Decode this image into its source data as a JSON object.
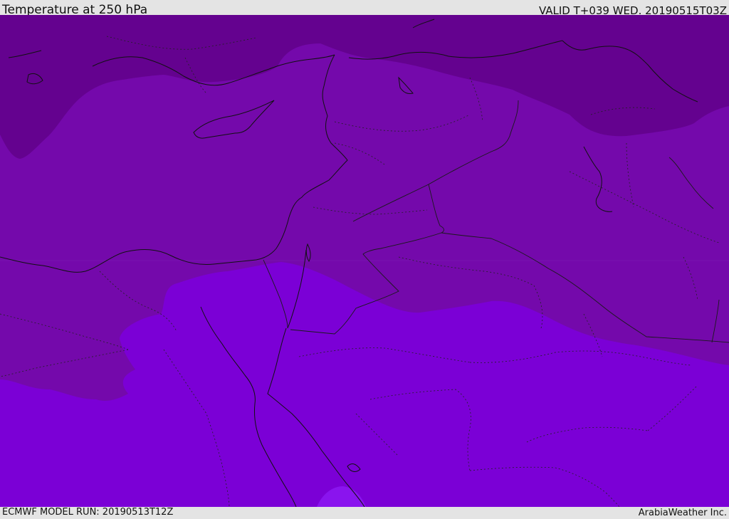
{
  "header": {
    "title": "Temperature at 250 hPa",
    "valid_time": "VALID T+039 WED. 20190515T03Z"
  },
  "footer": {
    "model_run": "ECMWF MODEL RUN: 20190513T12Z",
    "credit": "ArabiaWeather Inc."
  },
  "map": {
    "field": "temperature_250hPa",
    "colors": {
      "coldest": "#64028f",
      "cold": "#7409ab",
      "mild": "#7b00d6",
      "warm_spot": "#8a14ee",
      "coast_line": "#111111",
      "border_line": "#1a1a1a"
    }
  }
}
